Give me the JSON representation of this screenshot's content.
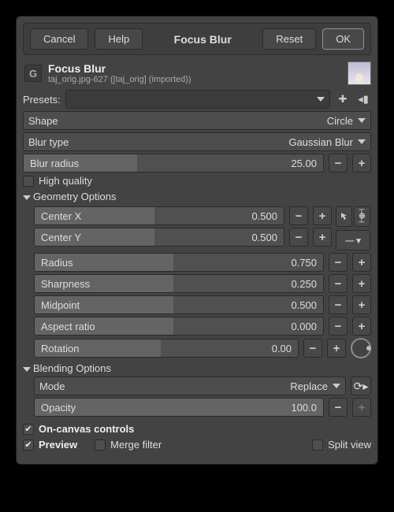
{
  "topbar": {
    "cancel": "Cancel",
    "help": "Help",
    "title": "Focus Blur",
    "reset": "Reset",
    "ok": "OK"
  },
  "header": {
    "title": "Focus Blur",
    "subtitle": "taj_orig.jpg-627 ([taj_orig] (imported))"
  },
  "presets_label": "Presets:",
  "shape": {
    "label": "Shape",
    "value": "Circle"
  },
  "blur_type": {
    "label": "Blur type",
    "value": "Gaussian Blur"
  },
  "blur_radius": {
    "label": "Blur radius",
    "value": "25.00",
    "fill": 38
  },
  "high_quality": "High quality",
  "geometry_title": "Geometry Options",
  "geo": {
    "center_x": {
      "label": "Center X",
      "value": "0.500",
      "fill": 48
    },
    "center_y": {
      "label": "Center Y",
      "value": "0.500",
      "fill": 48
    },
    "radius": {
      "label": "Radius",
      "value": "0.750",
      "fill": 48
    },
    "sharpness": {
      "label": "Sharpness",
      "value": "0.250",
      "fill": 48
    },
    "midpoint": {
      "label": "Midpoint",
      "value": "0.500",
      "fill": 48
    },
    "aspect": {
      "label": "Aspect ratio",
      "value": "0.000",
      "fill": 48
    },
    "rotation": {
      "label": "Rotation",
      "value": "0.00",
      "fill": 48
    }
  },
  "blending_title": "Blending Options",
  "mode": {
    "label": "Mode",
    "value": "Replace"
  },
  "opacity": {
    "label": "Opacity",
    "value": "100.0"
  },
  "on_canvas": "On-canvas controls",
  "preview": "Preview",
  "merge": "Merge filter",
  "split": "Split view"
}
